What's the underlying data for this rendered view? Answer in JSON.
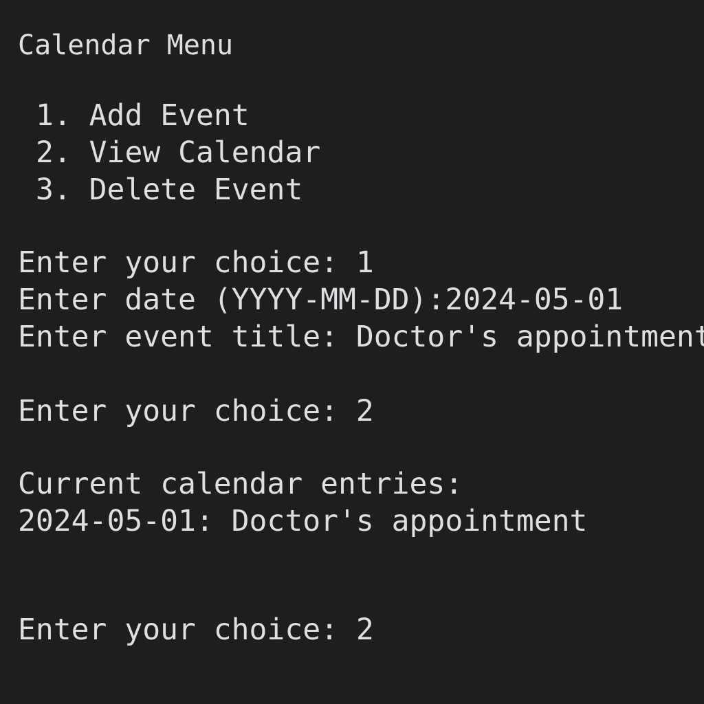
{
  "menu": {
    "title": "Calendar Menu",
    "items": [
      {
        "number": "1.",
        "label": "Add Event"
      },
      {
        "number": "2.",
        "label": "View Calendar"
      },
      {
        "number": "3.",
        "label": "Delete Event"
      }
    ]
  },
  "session": {
    "prompt_choice_1": "Enter your choice: 1",
    "prompt_date": "Enter date (YYYY-MM-DD):2024-05-01",
    "prompt_title": "Enter event title: Doctor's appointment",
    "prompt_choice_2": "Enter your choice: 2",
    "entries_header": "Current calendar entries:",
    "entry_1": "2024-05-01: Doctor's appointment",
    "prompt_choice_3": "Enter your choice: 2"
  }
}
